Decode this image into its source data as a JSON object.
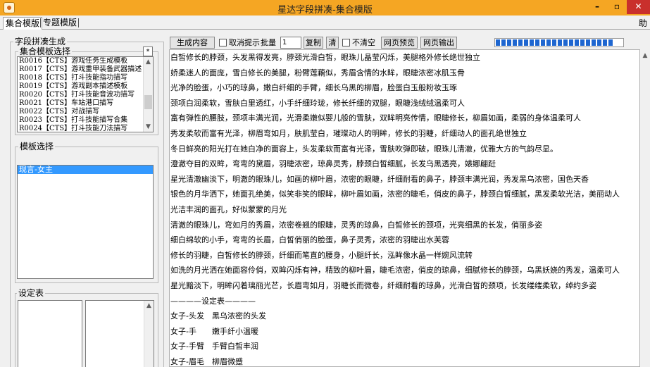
{
  "window": {
    "title": "星达字段拼凑-集合模版",
    "min_label": "–",
    "max_label": "▫",
    "close_label": "✕"
  },
  "tabs": [
    {
      "label": "集合模版"
    },
    {
      "label": "专题模版"
    }
  ],
  "help_label": "助",
  "left_panel": {
    "main_group_title": "字段拼凑生成",
    "collection_group_title": "集合模板选择",
    "star_label": "*",
    "collection_items": [
      "R0016【CTS】游戏任务生成模板",
      "R0017【CTS】游戏重甲装备武器描述",
      "R0018【CTS】打斗技能指功描写",
      "R0019【CTS】游戏副本描述模板",
      "R0020【CTS】打斗技能音波功描写",
      "R0021【CTS】车站港口描写",
      "R0022【CTS】对战描写",
      "R0023【CTS】打斗技能描写合集",
      "R0024【CTS】打斗技能刀法描写"
    ],
    "template_group_title": "模板选择",
    "template_items": [
      "现言-女主"
    ],
    "settings_label": "设定表"
  },
  "toolbar": {
    "generate": "生成内容",
    "cancel_hint": "取消提示",
    "batch": "批量",
    "batch_value": "1",
    "copy": "复制",
    "clear": "清",
    "no_clear": "不清空",
    "web_preview": "网页预览",
    "web_export": "网页输出",
    "progress_fraction": 0.92
  },
  "content_lines": [
    "白皙修长的脖颈，头发黑得发亮，脖颈光滑白皙，眼珠儿晶莹闪烁，美腿格外修长绝世独立",
    "娇柔迷人的面庞，雪白修长的美腿，粉臂莲藕似，秀眉含情的水眸，眼睫浓密冰肌玉骨",
    "光净的脸蛋，小巧的琼鼻，嫩白纤细的手臂，细长乌黑的柳眉，脸蛋白玉般粉妆玉琢",
    "颈项白润柔软，雪肤白里透红，小手纤细玲珑，修长纤细的双腿，眼睫浅绒绒温柔可人",
    "富有弹性的腰肢，颈项丰满光润，光滑柔嫩似婴儿般的雪肤，双眸明亮传情，眼睫修长，柳眉如画，柔弱的身体温柔可人",
    "秀发柔软而富有光泽，柳眉弯如月，肤肌莹白，璀璨动人的明眸，修长的羽睫，纤细动人的面孔绝世独立",
    "冬日鲜亮的阳光打在她白净的面容上，头发柔软而富有光泽，雪肤吹弹即破，眼珠儿清澈，优雅大方的气韵尽显。",
    "澄澈夺目的双眸，弯弯的黛眉，羽睫浓密，琼鼻灵秀，脖颈白皙细腻，长发乌黑透亮，婊娜翩跹",
    "星光清澈幽淡下，明澈的眼珠儿，如画的柳叶眉，浓密的眼睫，纤细耐看的鼻子，脖颈丰满光润，秀发黑乌浓密，国色天香",
    "银色的月华洒下，她面孔绝美，似笑非笑的眼眸，柳叶眉如画，浓密的睫毛，俏皮的鼻子，脖颈白皙细腻，黑发柔软光洁，美丽动人",
    "光洁丰润的面孔，好似蒙蒙的月光",
    "清澈的眼珠儿，弯如月的秀眉，浓密卷翘的眼睫，灵秀的琼鼻，白皙修长的颈项，光亮细黑的长发，俏丽多姿",
    "细白绵软的小手，弯弯的长眉，白皙俏丽的脸蛋，鼻子灵秀，浓密的羽睫出水芙蓉",
    "修长的羽睫，白皙修长的脖颈，纤细而笔直的腰身，小腿纤长，泓眸像水晶一样婉风流转",
    "如洗的月光洒在她面容伶俏，双眸闪烁有神，精致的柳叶眉，睫毛浓密，俏皮的琼鼻，细腻修长的脖颈，乌黑妖娆的秀发，温柔可人",
    "星光黯淡下，明眸闪着璃丽光芒，长眉弯如月，羽睫长而微卷，纤细耐看的琼鼻，光滑白皙的颈项，长发缕缕柔软，绰约多姿",
    "————设定表————",
    "女子-头发　黑乌浓密的头发",
    "女子-手　　嫩手纤小温暖",
    "女子-手臂　手臂白皙丰润",
    "女子-眉毛　柳眉微蹙"
  ]
}
